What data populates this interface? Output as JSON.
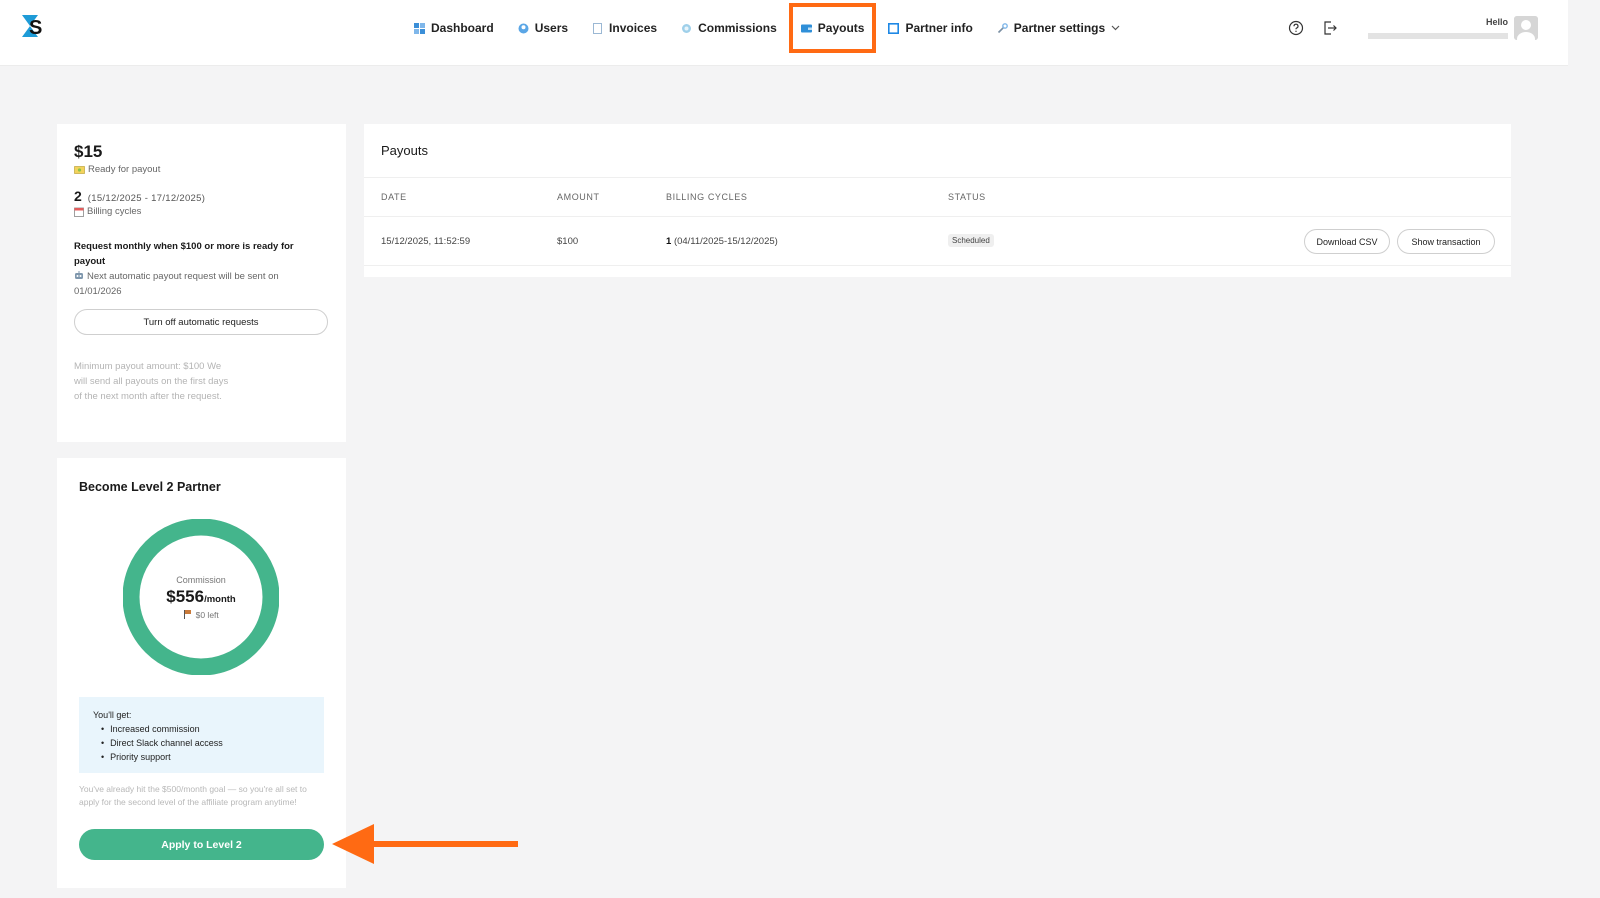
{
  "brand": {
    "accent": "#44b58c",
    "highlight": "#ff6a13"
  },
  "nav": {
    "items": [
      {
        "label": "Dashboard",
        "icon": "dashboard-icon"
      },
      {
        "label": "Users",
        "icon": "users-icon"
      },
      {
        "label": "Invoices",
        "icon": "invoice-icon"
      },
      {
        "label": "Commissions",
        "icon": "commissions-icon"
      },
      {
        "label": "Payouts",
        "icon": "wallet-icon",
        "active": true
      },
      {
        "label": "Partner info",
        "icon": "partner-info-icon"
      },
      {
        "label": "Partner settings",
        "icon": "wrench-icon"
      }
    ]
  },
  "header": {
    "hello": "Hello"
  },
  "summary": {
    "amount": "$15",
    "ready_label": "Ready for payout",
    "cycles_count": "2",
    "cycles_range": "(15/12/2025  -  17/12/2025)",
    "cycles_label": "Billing cycles",
    "request_bold": "Request monthly when $100 or more is ready for payout",
    "request_note": "Next automatic payout request will be sent on 01/01/2026",
    "toggle_button": "Turn off automatic requests",
    "minimum_note": "Minimum payout amount: $100 We will send all payouts on the first days of the next month after the request."
  },
  "level": {
    "title": "Become Level 2 Partner",
    "commission_caption": "Commission",
    "commission_value": "$556",
    "commission_unit": "/month",
    "left_text": "$0 left",
    "progress": 1.0,
    "benefits_title": "You'll get:",
    "benefits": [
      "Increased commission",
      "Direct Slack channel access",
      "Priority support"
    ],
    "goal_note": "You've already hit the $500/month goal — so you're all set to apply for the second level of the affiliate program anytime!",
    "apply_button": "Apply to Level 2"
  },
  "payouts": {
    "title": "Payouts",
    "columns": [
      "DATE",
      "AMOUNT",
      "BILLING CYCLES",
      "STATUS"
    ],
    "rows": [
      {
        "date": "15/12/2025, 11:52:59",
        "amount": "$100",
        "cycles_count": "1",
        "cycles_range": "(04/11/2025-15/12/2025)",
        "status": "Scheduled",
        "download_label": "Download CSV",
        "show_label": "Show transaction"
      }
    ]
  }
}
